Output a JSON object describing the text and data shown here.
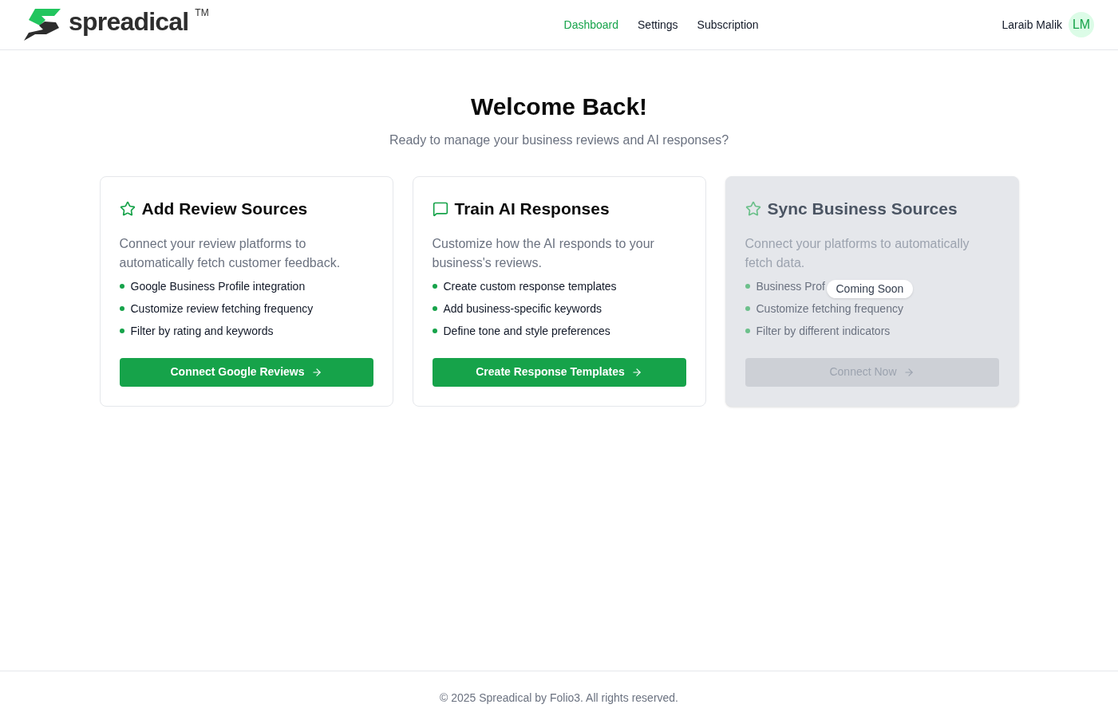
{
  "header": {
    "brand": "spreadical",
    "trademark": "TM",
    "nav": [
      {
        "label": "Dashboard",
        "selected": true
      },
      {
        "label": "Settings",
        "selected": false
      },
      {
        "label": "Subscription",
        "selected": false
      }
    ],
    "user": {
      "name": "Laraib Malik",
      "initials": "LM"
    }
  },
  "hero": {
    "title": "Welcome Back!",
    "subtitle": "Ready to manage your business reviews and AI responses?"
  },
  "cards": [
    {
      "title": "Add Review Sources",
      "description": "Connect your review platforms to automatically fetch customer feedback.",
      "features": [
        "Google Business Profile integration",
        "Customize review fetching frequency",
        "Filter by rating and keywords"
      ],
      "button": "Connect Google Reviews",
      "disabled": false
    },
    {
      "title": "Train AI Responses",
      "description": "Customize how the AI responds to your business's reviews.",
      "features": [
        "Create custom response templates",
        "Add business-specific keywords",
        "Define tone and style preferences"
      ],
      "button": "Create Response Templates",
      "disabled": false
    },
    {
      "title": "Sync Business Sources",
      "description": "Connect your platforms to automatically fetch data.",
      "features": [
        "Business Prof",
        "Customize fetching frequency",
        "Filter by different indicators"
      ],
      "button": "Connect Now",
      "disabled": true,
      "badge": "Coming Soon"
    }
  ],
  "footer": {
    "text": "© 2025 Spreadical by Folio3. All rights reserved."
  }
}
